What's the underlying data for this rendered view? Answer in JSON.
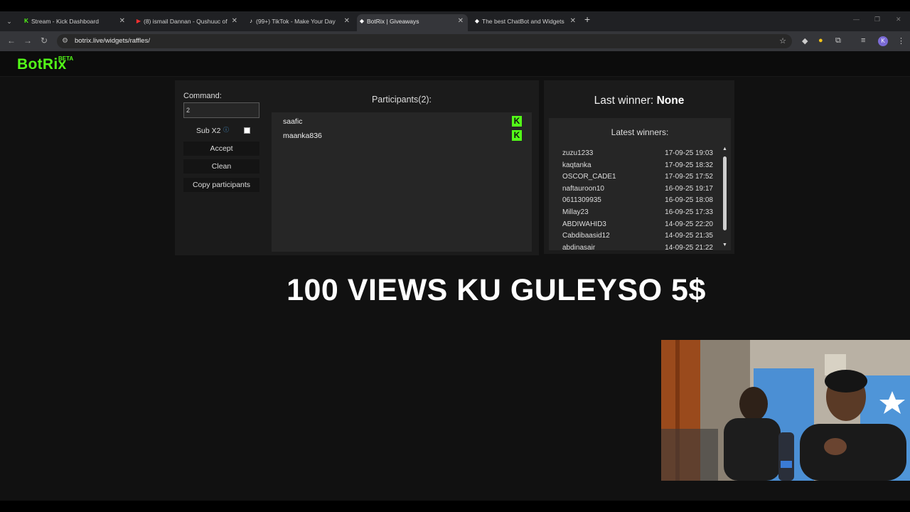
{
  "browser": {
    "tabs": [
      {
        "title": "Stream - Kick Dashboard",
        "icon": "kick-icon",
        "color": "#53fc18",
        "active": false
      },
      {
        "title": "(8) ismail Dannan - Qushuuc of",
        "icon": "youtube-icon",
        "color": "#ff0000",
        "active": false
      },
      {
        "title": "(99+) TikTok - Make Your Day",
        "icon": "tiktok-icon",
        "color": "#ffffff",
        "active": false
      },
      {
        "title": "BotRix | Giveaways",
        "icon": "botrix-icon",
        "color": "#ffffff",
        "active": true
      },
      {
        "title": "The best ChatBot and Widgets",
        "icon": "botrix-icon",
        "color": "#ffffff",
        "active": false
      }
    ],
    "url": "botrix.live/widgets/raffles/",
    "profile_initial": "K"
  },
  "site": {
    "logo": "BotRix",
    "beta": "BETA",
    "brand_color": "#53fc18"
  },
  "raffle": {
    "command_label": "Command:",
    "command_value": "2",
    "sub_label": "Sub X2",
    "sub_checked": false,
    "accept_label": "Accept",
    "clean_label": "Clean",
    "copy_label": "Copy participants",
    "participants_title": "Participants(2):",
    "participants": [
      {
        "name": "saafic",
        "platform": "kick"
      },
      {
        "name": "maanka836",
        "platform": "kick"
      }
    ]
  },
  "winners": {
    "last_winner_label": "Last winner:",
    "last_winner_value": "None",
    "latest_title": "Latest winners:",
    "list": [
      {
        "name": "zuzu1233",
        "date": "17-09-25 19:03"
      },
      {
        "name": "kaqtanka",
        "date": "17-09-25 18:32"
      },
      {
        "name": "OSCOR_CADE1",
        "date": "17-09-25 17:52"
      },
      {
        "name": "naftauroon10",
        "date": "16-09-25 19:17"
      },
      {
        "name": "0611309935",
        "date": "16-09-25 18:08"
      },
      {
        "name": "Millay23",
        "date": "16-09-25 17:33"
      },
      {
        "name": "ABDIWAHID3",
        "date": "14-09-25 22:20"
      },
      {
        "name": "Cabdibaasid12",
        "date": "14-09-25 21:35"
      },
      {
        "name": "abdinasair",
        "date": "14-09-25 21:22"
      }
    ]
  },
  "overlay": {
    "text": "100 VIEWS KU GULEYSO 5$"
  }
}
